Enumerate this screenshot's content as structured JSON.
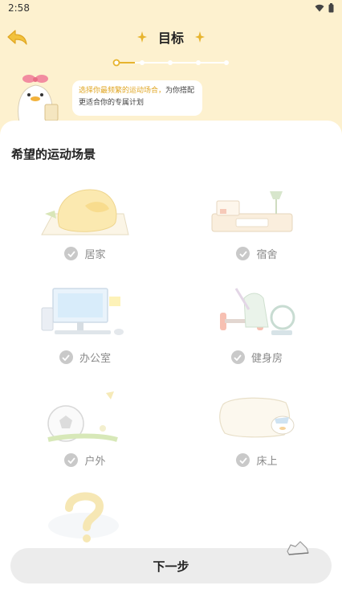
{
  "status_bar": {
    "time": "2:58",
    "icons": [
      "wifi-icon",
      "battery-icon"
    ]
  },
  "header": {
    "title": "目标",
    "back_icon": "back-arrow-icon"
  },
  "progress": {
    "current_step": 1,
    "total_steps": 5
  },
  "tip": {
    "highlight": "选择你最频繁的运动场合，",
    "rest": "为你搭配更适合你的专属计划"
  },
  "section_title": "希望的运动场景",
  "options": [
    {
      "label": "居家",
      "icon": "home-couch-icon"
    },
    {
      "label": "宿舍",
      "icon": "dorm-desk-icon"
    },
    {
      "label": "办公室",
      "icon": "office-computer-icon"
    },
    {
      "label": "健身房",
      "icon": "gym-equipment-icon"
    },
    {
      "label": "户外",
      "icon": "soccer-ball-icon"
    },
    {
      "label": "床上",
      "icon": "bed-pillow-icon"
    },
    {
      "label": "",
      "icon": "question-mark-icon"
    }
  ],
  "next_button": "下一步",
  "colors": {
    "accent": "#f2c94c",
    "page_bg": "#fdf1cf",
    "button_bg": "#ececec",
    "check": "#c9c9c9"
  }
}
